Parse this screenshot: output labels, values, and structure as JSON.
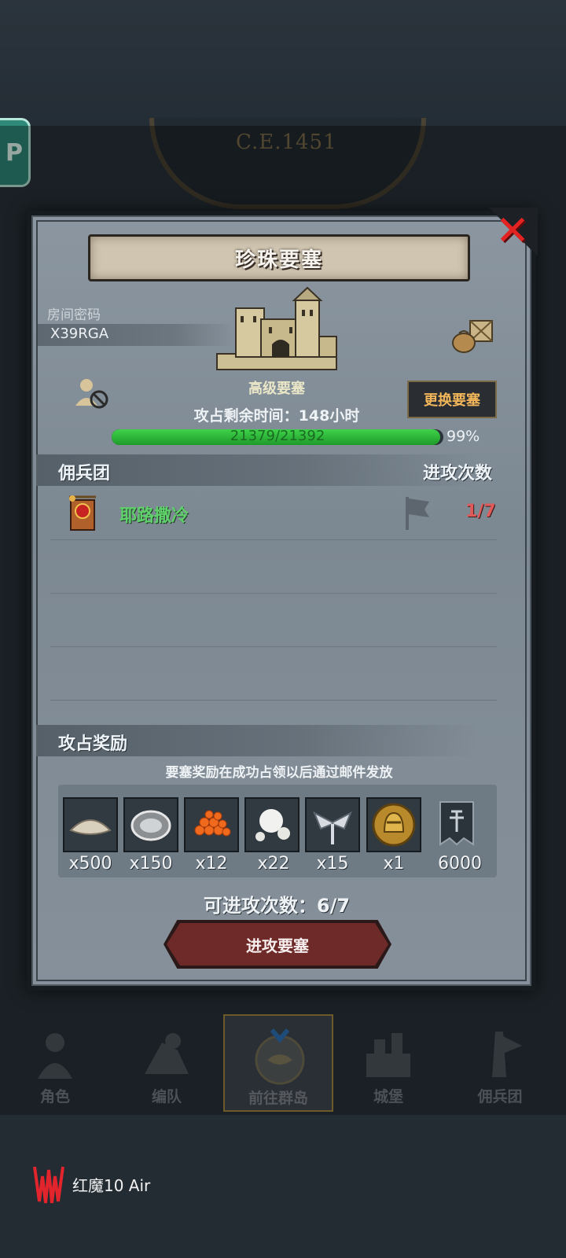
{
  "background": {
    "era_text": "C.E.1451",
    "side_chip_text": "P"
  },
  "modal": {
    "title": "珍珠要塞",
    "room_label": "房间密码",
    "room_code": "X39RGA",
    "fortress_level": "高级要塞",
    "change_button": "更换要塞",
    "remaining_time": "攻占剩余时间：148小时",
    "hp_text": "21379/21392",
    "hp_percent": "99%",
    "hp_fraction": 0.99,
    "mercenary_header": "佣兵团",
    "attack_count_header": "进攻次数",
    "mercenary_rows": [
      {
        "name": "耶路撒冷",
        "count": "1/7"
      }
    ],
    "rewards_header": "攻占奖励",
    "reward_note": "要塞奖励在成功占领以后通过邮件发放",
    "rewards": [
      {
        "icon": "flour-icon",
        "qty": "x500"
      },
      {
        "icon": "oyster-icon",
        "qty": "x150"
      },
      {
        "icon": "fish-roe-icon",
        "qty": "x12"
      },
      {
        "icon": "pearl-icon",
        "qty": "x22"
      },
      {
        "icon": "winged-emblem-icon",
        "qty": "x15"
      },
      {
        "icon": "knight-coin-icon",
        "qty": "x1"
      },
      {
        "icon": "banner-icon",
        "qty": "6000"
      }
    ],
    "available_attacks": "可进攻次数：6/7",
    "attack_button": "进攻要塞"
  },
  "bottom_nav": [
    {
      "label": "角色",
      "icon": "knight-icon",
      "active": false
    },
    {
      "label": "编队",
      "icon": "squad-icon",
      "active": false
    },
    {
      "label": "前往群岛",
      "icon": "island-compass-icon",
      "active": true
    },
    {
      "label": "城堡",
      "icon": "castle-icon",
      "active": false
    },
    {
      "label": "佣兵团",
      "icon": "mercenary-icon",
      "active": false
    }
  ],
  "device_watermark": "红魔10 Air",
  "colors": {
    "hp_green": "#3fd24a",
    "merc_name_green": "#5fd16a",
    "count_red": "#e05a5a",
    "change_button_orange": "#f2b65a",
    "close_red": "#e32222"
  }
}
